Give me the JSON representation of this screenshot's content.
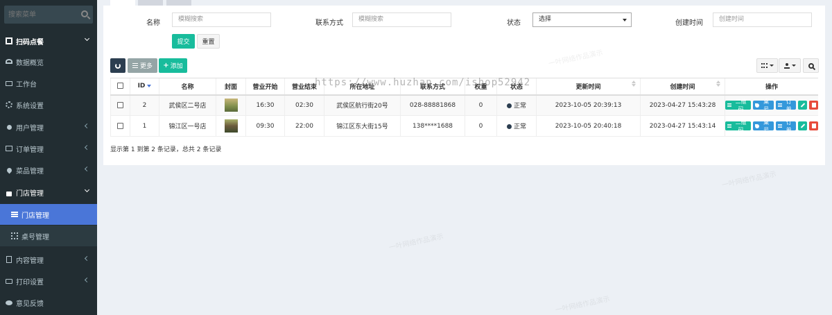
{
  "sidebar": {
    "search_placeholder": "搜索菜单",
    "menu": {
      "scan_order": "扫码点餐",
      "dashboard": "数据概览",
      "workbench": "工作台",
      "settings": "系统设置",
      "users": "用户管理",
      "orders": "订单管理",
      "dishes": "菜品管理",
      "stores_group": "门店管理",
      "stores": "门店管理",
      "tables": "桌号管理",
      "content": "内容管理",
      "print": "打印设置",
      "feedback": "意见反馈"
    }
  },
  "filters": {
    "name_label": "名称",
    "name_placeholder": "模糊搜索",
    "contact_label": "联系方式",
    "contact_placeholder": "模糊搜索",
    "status_label": "状态",
    "status_value": "选择",
    "created_label": "创建时间",
    "created_placeholder": "创建时间",
    "submit": "提交",
    "reset": "重置"
  },
  "toolbar": {
    "more": "更多",
    "add": "添加"
  },
  "table": {
    "headers": {
      "id": "ID",
      "name": "名称",
      "cover": "封面",
      "open": "营业开始",
      "close": "营业结束",
      "address": "所在地址",
      "phone": "联系方式",
      "weight": "权重",
      "status": "状态",
      "updated": "更新时间",
      "created": "创建时间",
      "ops": "操作"
    },
    "rows": [
      {
        "id": "2",
        "name": "武侯区二号店",
        "open": "16:30",
        "close": "02:30",
        "address": "武侯区航行街20号",
        "phone": "028-88881868",
        "weight": "0",
        "status": "正常",
        "updated": "2023-10-05 20:39:13",
        "created": "2023-04-27 15:43:28"
      },
      {
        "id": "1",
        "name": "锦江区一号店",
        "open": "09:30",
        "close": "22:00",
        "address": "锦江区东大街15号",
        "phone": "138****1688",
        "weight": "0",
        "status": "正常",
        "updated": "2023-10-05 20:40:18",
        "created": "2023-04-27 15:43:14"
      }
    ],
    "ops": {
      "qrcode": "二维码",
      "table_no": "桌号",
      "order": "订单"
    }
  },
  "summary": "显示第 1 到第 2 条记录，总共 2 条记录",
  "overlay_url": "https://www.huzhan.com/ishop52942",
  "watermark": "一叶网络作品演示",
  "colors": {
    "sidebar_bg": "#222d32",
    "active_menu": "#4a76d8",
    "primary_green": "#18bc9c",
    "info_blue": "#3498db",
    "danger_red": "#e74c3c",
    "dark_button": "#2c3e50"
  }
}
